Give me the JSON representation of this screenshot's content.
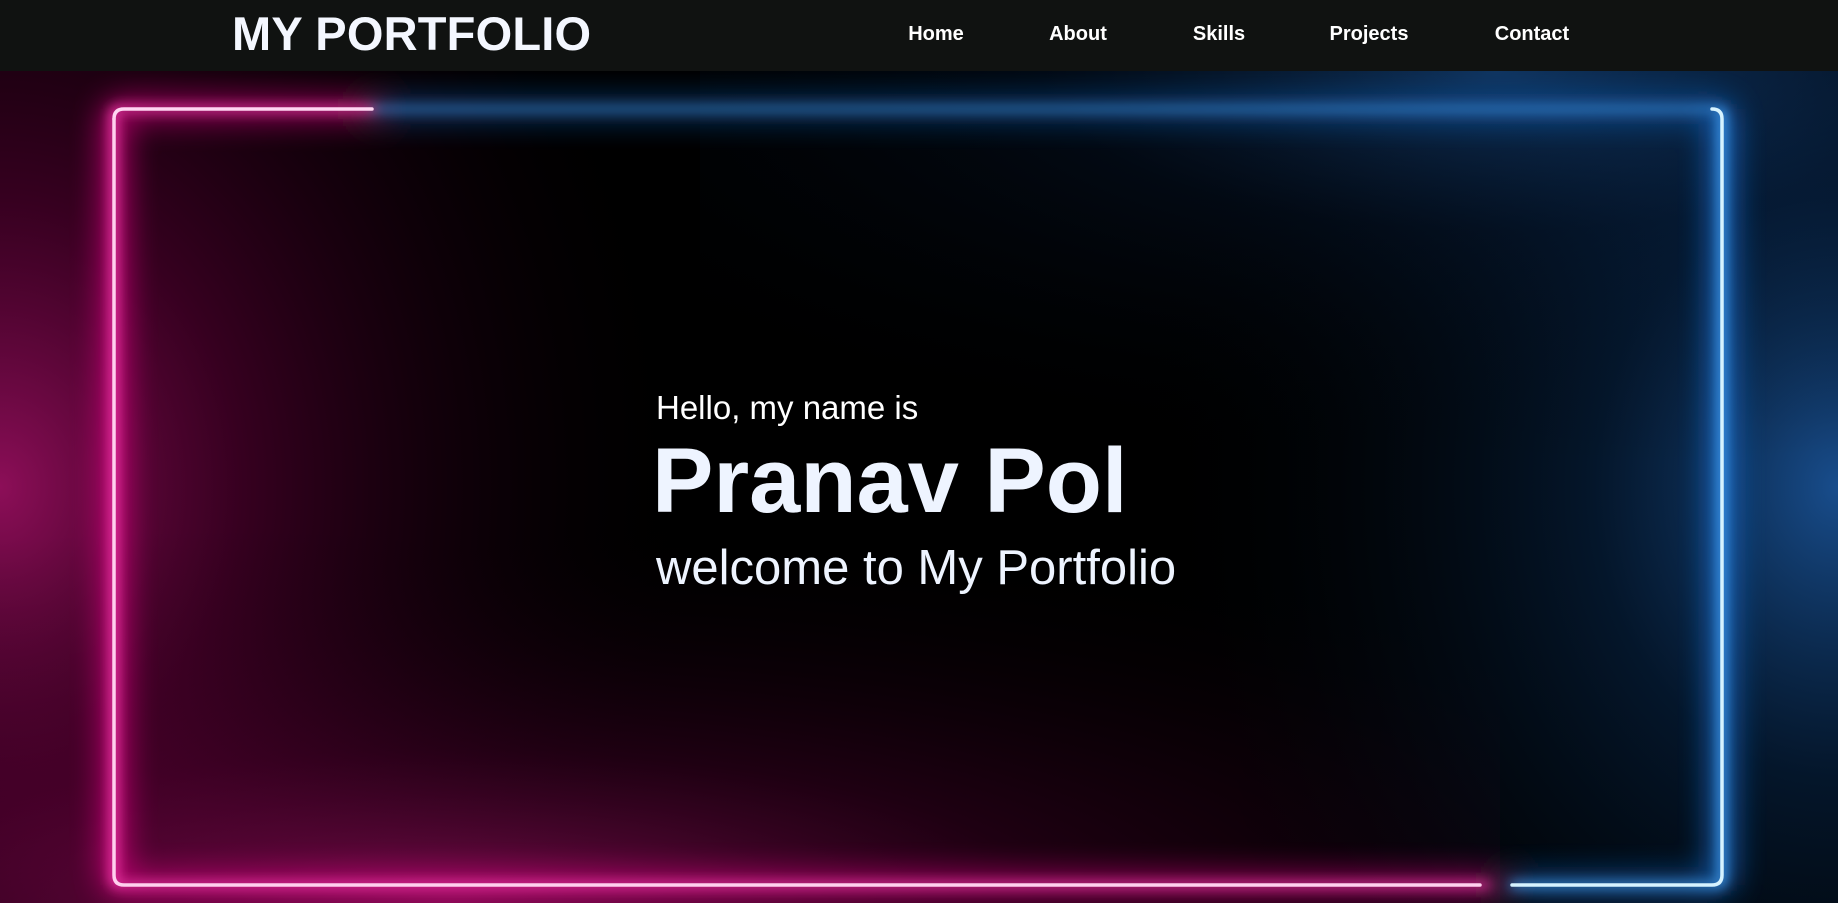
{
  "header": {
    "logo": "MY PORTFOLIO",
    "nav": [
      "Home",
      "About",
      "Skills",
      "Projects",
      "Contact"
    ]
  },
  "hero": {
    "greeting": "Hello, my name is",
    "name": "Pranav Pol",
    "welcome": "welcome to My Portfolio"
  },
  "colors": {
    "navbar_bg": "#101211",
    "hero_bg": "#000000",
    "neon_pink": "#ff1fa0",
    "neon_blue": "#33aaff",
    "text": "#eef4ff"
  }
}
